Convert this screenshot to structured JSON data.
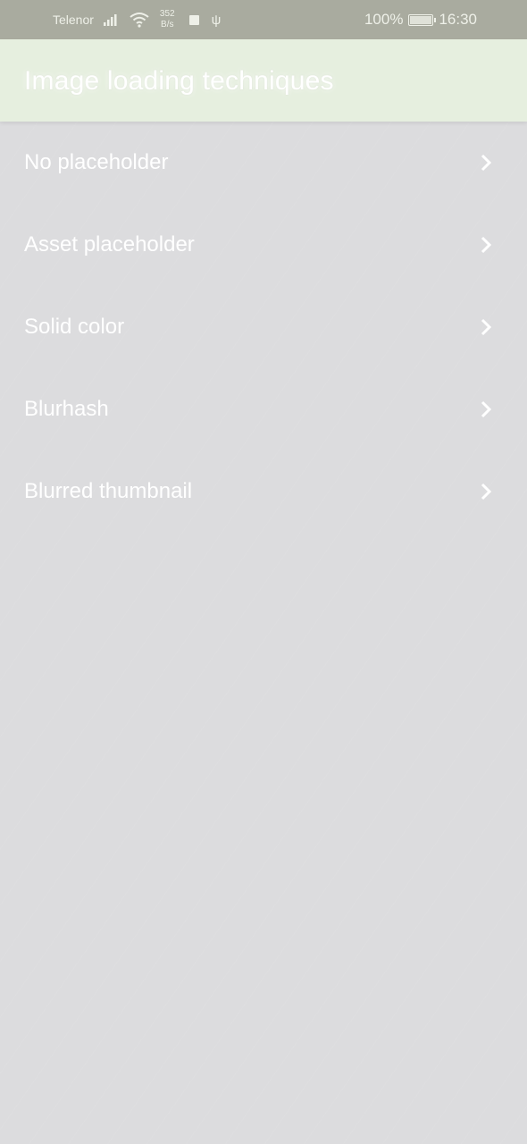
{
  "status_bar": {
    "carrier": "Telenor",
    "speed_value": "352",
    "speed_unit": "B/s",
    "battery": "100%",
    "battery_level": 1.0,
    "time": "16:30",
    "icons": [
      "signal-icon",
      "wifi-icon",
      "notification-square-icon",
      "usb-icon",
      "battery-icon"
    ]
  },
  "app_bar": {
    "title": "Image loading techniques"
  },
  "list": {
    "items": [
      {
        "label": "No placeholder",
        "icon": "chevron-right-icon"
      },
      {
        "label": "Asset placeholder",
        "icon": "chevron-right-icon"
      },
      {
        "label": "Solid color",
        "icon": "chevron-right-icon"
      },
      {
        "label": "Blurhash",
        "icon": "chevron-right-icon"
      },
      {
        "label": "Blurred thumbnail",
        "icon": "chevron-right-icon"
      }
    ]
  },
  "colors": {
    "status_bar_bg": "#a9ab9f",
    "app_bar_bg": "#e6efdf",
    "body_bg": "#dcdcde",
    "text": "#ffffff"
  }
}
